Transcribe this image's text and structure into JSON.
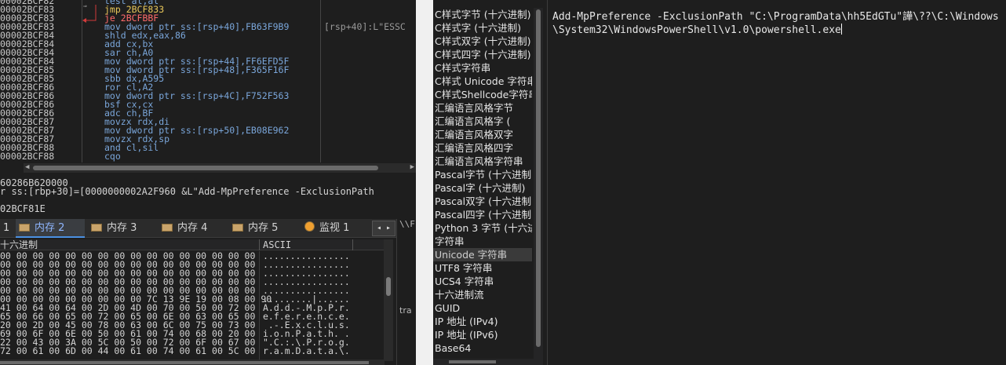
{
  "disasm": {
    "rows": [
      {
        "addr": "00002BCF82",
        "ins": "test al,al",
        "cls": "m-alu"
      },
      {
        "addr": "00002BCF83",
        "ins": "jmp 2BCF833",
        "cls": "m-jmp"
      },
      {
        "addr": "00002BCF83",
        "ins": "je 2BCFBBF",
        "cls": "m-je"
      },
      {
        "addr": "00002BCF83",
        "ins": "mov dword ptr ss:[rsp+40],FB63F9B9",
        "cls": "m-mov",
        "cmt": "[rsp+40]:L\"ESSC"
      },
      {
        "addr": "00002BCF84",
        "ins": "shld edx,eax,86",
        "cls": "m-alu"
      },
      {
        "addr": "00002BCF84",
        "ins": "add cx,bx",
        "cls": "m-alu"
      },
      {
        "addr": "00002BCF84",
        "ins": "sar ch,A0",
        "cls": "m-alu"
      },
      {
        "addr": "00002BCF84",
        "ins": "mov dword ptr ss:[rsp+44],FF6EFD5F",
        "cls": "m-mov"
      },
      {
        "addr": "00002BCF85",
        "ins": "mov dword ptr ss:[rsp+48],F365F16F",
        "cls": "m-mov"
      },
      {
        "addr": "00002BCF85",
        "ins": "sbb dx,A595",
        "cls": "m-alu"
      },
      {
        "addr": "00002BCF86",
        "ins": "ror cl,A2",
        "cls": "m-alu"
      },
      {
        "addr": "00002BCF86",
        "ins": "mov dword ptr ss:[rsp+4C],F752F563",
        "cls": "m-mov"
      },
      {
        "addr": "00002BCF86",
        "ins": "bsf cx,cx",
        "cls": "m-alu"
      },
      {
        "addr": "00002BCF86",
        "ins": "adc ch,BF",
        "cls": "m-alu"
      },
      {
        "addr": "00002BCF87",
        "ins": "movzx rdx,di",
        "cls": "m-alu"
      },
      {
        "addr": "00002BCF87",
        "ins": "mov dword ptr ss:[rsp+50],EB08E962",
        "cls": "m-mov"
      },
      {
        "addr": "00002BCF87",
        "ins": "movzx rdx,sp",
        "cls": "m-alu"
      },
      {
        "addr": "00002BCF88",
        "ins": "and cl,sil",
        "cls": "m-alu"
      },
      {
        "addr": "00002BCF88",
        "ins": "cqo",
        "cls": "m-alu"
      }
    ]
  },
  "info": {
    "line1": "60286B620000",
    "line2": "r ss:[rbp+30]=[0000000002A2F960 &L\"Add-MpPreference -ExclusionPath",
    "line3": "02BCF81E"
  },
  "tabs": [
    {
      "label": "1",
      "icon": "none"
    },
    {
      "label": "内存 2",
      "icon": "memory"
    },
    {
      "label": "内存 3",
      "icon": "memory"
    },
    {
      "label": "内存 4",
      "icon": "memory"
    },
    {
      "label": "内存 5",
      "icon": "memory"
    },
    {
      "label": "监视 1",
      "icon": "watch"
    }
  ],
  "tab_nav": "◂ ▸",
  "mem_header": {
    "hex": "十六进制",
    "ascii": "ASCII"
  },
  "mem_rows": [
    {
      "hex": "00 00 00 00 00 00 00 00 00 00 00 00 00 00 00 00",
      "ascii": "................"
    },
    {
      "hex": "00 00 00 00 00 00 00 00 00 00 00 00 00 00 00 00",
      "ascii": "................"
    },
    {
      "hex": "00 00 00 00 00 00 00 00 00 00 00 00 00 00 00 00",
      "ascii": "................"
    },
    {
      "hex": "00 00 00 00 00 00 00 00 00 00 00 00 00 00 00 00",
      "ascii": "................"
    },
    {
      "hex": "00 00 00 00 00 00 00 00 00 00 00 00 00 00 00 00",
      "ascii": "................"
    },
    {
      "hex": "00 00 00 00 00 00 00 00 00 7C 13 9E 19 00 08 00 90",
      "ascii": ".........|......"
    },
    {
      "hex": "41 00 64 00 64 00 2D 00 4D 00 70 00 50 00 72 00",
      "ascii": "A.d.d.-.M.p.P.r."
    },
    {
      "hex": "65 00 66 00 65 00 72 00 65 00 6E 00 63 00 65 00",
      "ascii": "e.f.e.r.e.n.c.e."
    },
    {
      "hex": "20 00 2D 00 45 00 78 00 63 00 6C 00 75 00 73 00",
      "ascii": " .-.E.x.c.l.u.s."
    },
    {
      "hex": "69 00 6F 00 6E 00 50 00 61 00 74 00 68 00 20 00",
      "ascii": "i.o.n.P.a.t.h. ."
    },
    {
      "hex": "22 00 43 00 3A 00 5C 00 50 00 72 00 6F 00 67 00",
      "ascii": "\".C.:.\\.P.r.o.g."
    },
    {
      "hex": "72 00 61 00 6D 00 44 00 61 00 74 00 61 00 5C 00",
      "ascii": "r.a.m.D.a.t.a.\\."
    }
  ],
  "sliver": {
    "a": "\\\\F",
    "b": "tra"
  },
  "formats": [
    "C样式字节 (十六进制)",
    "C样式字 (十六进制)",
    "C样式双字 (十六进制)",
    "C样式四字 (十六进制)",
    "C样式字符串",
    "C样式 Unicode 字符串",
    "C样式Shellcode字符串",
    "汇编语言风格字节",
    "汇编语言风格字 (",
    "汇编语言风格双字",
    "汇编语言风格四字",
    "汇编语言风格字符串",
    "Pascal字节 (十六进制)",
    "Pascal字 (十六进制)",
    "Pascal双字 (十六进制)",
    "Pascal四字 (十六进制)",
    "Python 3 字节 (十六进制)",
    "字符串",
    "Unicode 字符串",
    "UTF8 字符串",
    "UCS4 字符串",
    "十六进制流",
    "GUID",
    "IP 地址 (IPv4)",
    "IP 地址 (IPv6)",
    "Base64"
  ],
  "selected_format": "Unicode 字符串",
  "output_text": "Add-MpPreference -ExclusionPath \"C:\\ProgramData\\hh5EdGTu\"\u0013譁\\??\\C:\\Windows\\System32\\WindowsPowerShell\\v1.0\\powershell.exe"
}
